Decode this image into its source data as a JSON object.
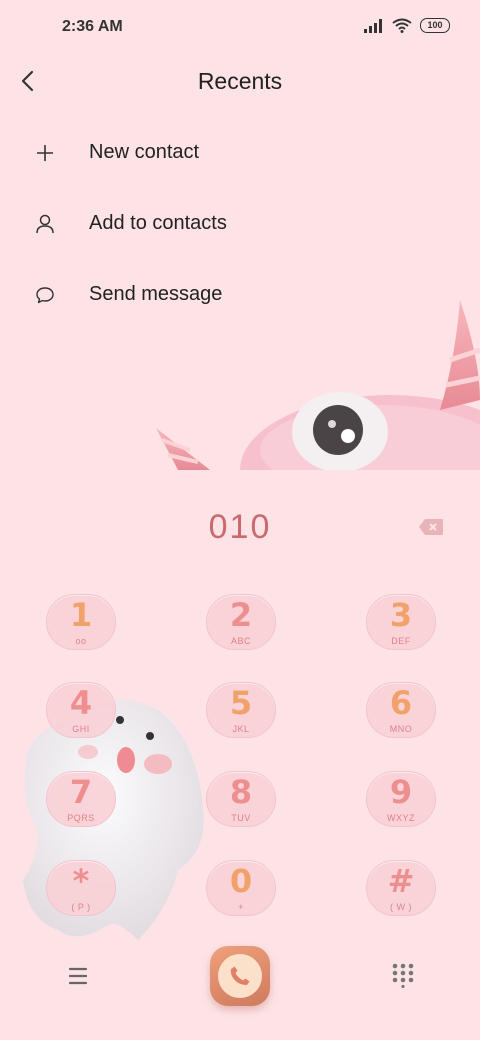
{
  "status": {
    "time": "2:36 AM",
    "battery": "100"
  },
  "header": {
    "title": "Recents"
  },
  "menu": [
    {
      "label": "New contact",
      "icon": "plus-icon"
    },
    {
      "label": "Add to contacts",
      "icon": "person-icon"
    },
    {
      "label": "Send message",
      "icon": "chat-bubble-icon"
    }
  ],
  "dialer": {
    "number": "010",
    "keys": [
      {
        "digit": "1",
        "letters": "oo"
      },
      {
        "digit": "2",
        "letters": "ABC"
      },
      {
        "digit": "3",
        "letters": "DEF"
      },
      {
        "digit": "4",
        "letters": "GHI"
      },
      {
        "digit": "5",
        "letters": "JKL"
      },
      {
        "digit": "6",
        "letters": "MNO"
      },
      {
        "digit": "7",
        "letters": "PQRS"
      },
      {
        "digit": "8",
        "letters": "TUV"
      },
      {
        "digit": "9",
        "letters": "WXYZ"
      },
      {
        "digit": "*",
        "letters": "( P )"
      },
      {
        "digit": "0",
        "letters": "+"
      },
      {
        "digit": "#",
        "letters": "( W )"
      }
    ]
  },
  "colors": {
    "background": "#fde3e6",
    "digit_text": "#c96970",
    "key_digit": "#f0a26a",
    "call_button": "#e08c6c"
  }
}
